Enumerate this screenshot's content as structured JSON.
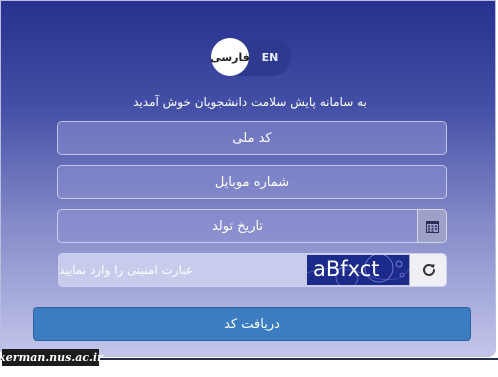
{
  "language": {
    "fa_label": "فارسی",
    "en_label": "EN",
    "selected": "fa"
  },
  "welcome_text": "به سامانه پایش سلامت دانشجویان خوش آمدید",
  "form": {
    "national_id_placeholder": "کد ملی",
    "mobile_placeholder": "شماره موبایل",
    "birthdate_placeholder": "تاریخ تولد",
    "captcha_placeholder": "عبارت امنیتی را وارد نمایید",
    "captcha_code": "aBfxct",
    "submit_label": "دریافت کد"
  },
  "watermark": "kerman.nus.ac.ir",
  "icons": {
    "calendar": "calendar-icon",
    "refresh": "refresh-icon"
  },
  "colors": {
    "accent": "#3b7dc0",
    "panel_top": "#27318f",
    "panel_bottom": "#c3c6ea"
  }
}
